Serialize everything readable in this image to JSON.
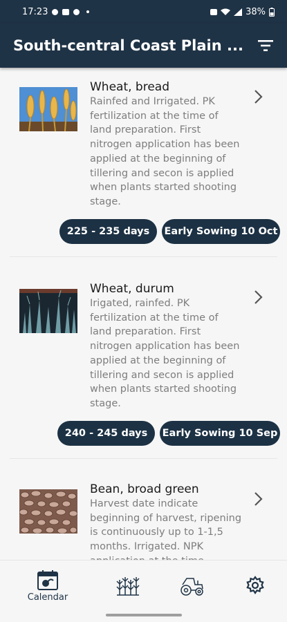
{
  "status_bar": {
    "time": "17:23",
    "battery": "38%"
  },
  "app_bar": {
    "title": "South-central Coast Plain ...",
    "filter_icon": "filter-icon"
  },
  "crops": [
    {
      "name": "Wheat, bread",
      "description": "Rainfed and Irrigated. PK fertilization at the time of land preparation. First nitrogen application has been applied at the beginning of tillering and secon is applied when plants started shooting stage.",
      "duration": "225 - 235 days",
      "sowing": "Early Sowing 10 Oct"
    },
    {
      "name": "Wheat, durum",
      "description": "Irigated, rainfed. PK fertilization at the time of land preparation. First nitrogen application has been applied at the beginning of tillering and secon is applied when plants started shooting stage.",
      "duration": "240 - 245 days",
      "sowing": "Early Sowing 10 Sep"
    },
    {
      "name": "Bean, broad green",
      "description": "Harvest date indicate beginning of harvest, ripening is continuously up to 1-1,5 months. Irrigated. NPK application at the time"
    }
  ],
  "bottom_nav": {
    "calendar_label": "Calendar",
    "icons": [
      "calendar-icon",
      "crops-icon",
      "tractor-icon",
      "settings-icon"
    ]
  }
}
